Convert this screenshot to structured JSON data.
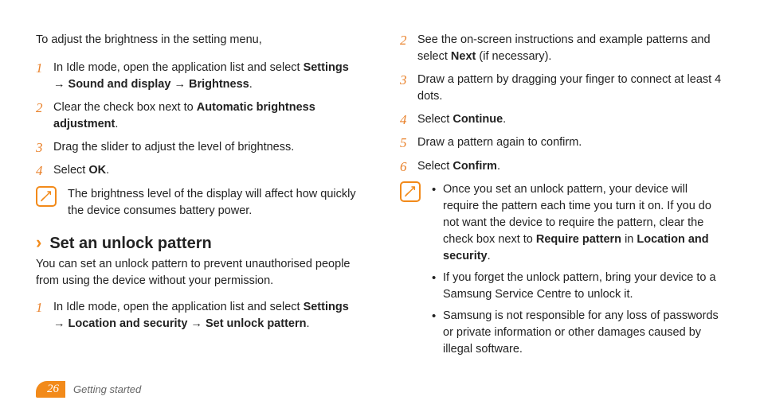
{
  "left": {
    "intro": "To adjust the brightness in the setting menu,",
    "steps": [
      {
        "num": "1",
        "prefix": "In Idle mode, open the application list and select ",
        "bold1": "Settings",
        "arrow1": " → ",
        "bold2": "Sound and display",
        "arrow2": " → ",
        "bold3": "Brightness",
        "suffix": "."
      },
      {
        "num": "2",
        "prefix": "Clear the check box next to ",
        "bold1": "Automatic brightness adjustment",
        "suffix": "."
      },
      {
        "num": "3",
        "text": "Drag the slider to adjust the level of brightness."
      },
      {
        "num": "4",
        "prefix": "Select ",
        "bold1": "OK",
        "suffix": "."
      }
    ],
    "note": "The brightness level of the display will affect how quickly the device consumes battery power.",
    "section": {
      "title": "Set an unlock pattern",
      "desc": "You can set an unlock pattern to prevent unauthorised people from using the device without your permission.",
      "steps": [
        {
          "num": "1",
          "prefix": "In Idle mode, open the application list and select ",
          "bold1": "Settings",
          "arrow1": " → ",
          "bold2": "Location and security",
          "arrow2": " → ",
          "bold3": "Set unlock pattern",
          "suffix": "."
        }
      ]
    }
  },
  "right": {
    "steps": [
      {
        "num": "2",
        "prefix": "See the on-screen instructions and example patterns and select ",
        "bold1": "Next",
        "suffix": " (if necessary)."
      },
      {
        "num": "3",
        "text": "Draw a pattern by dragging your finger to connect at least 4 dots."
      },
      {
        "num": "4",
        "prefix": "Select ",
        "bold1": "Continue",
        "suffix": "."
      },
      {
        "num": "5",
        "text": "Draw a pattern again to confirm."
      },
      {
        "num": "6",
        "prefix": "Select ",
        "bold1": "Confirm",
        "suffix": "."
      }
    ],
    "note_bullets": [
      {
        "prefix": "Once you set an unlock pattern, your device will require the pattern each time you turn it on. If you do not want the device to require the pattern, clear the check box next to ",
        "bold1": "Require pattern",
        "mid": " in ",
        "bold2": "Location and security",
        "suffix": "."
      },
      {
        "text": "If you forget the unlock pattern, bring your device to a Samsung Service Centre to unlock it."
      },
      {
        "text": "Samsung is not responsible for any loss of passwords or private information or other damages caused by illegal software."
      }
    ]
  },
  "footer": {
    "page": "26",
    "section": "Getting started"
  }
}
